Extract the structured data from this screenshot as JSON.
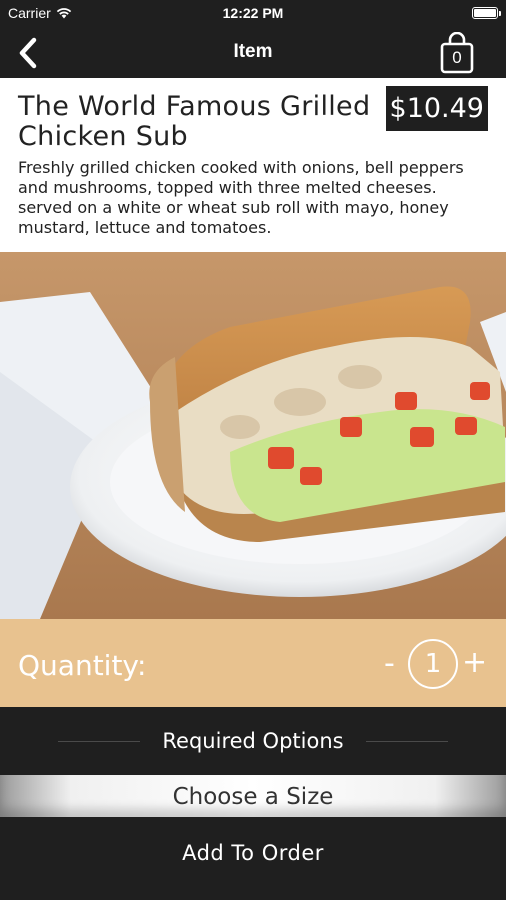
{
  "status_bar": {
    "carrier": "Carrier",
    "time": "12:22 PM",
    "battery_level": 1.0
  },
  "nav": {
    "title": "Item",
    "back_icon": "chevron-left-icon",
    "cart_icon": "shopping-bag-icon",
    "cart_count": "0"
  },
  "item": {
    "name": "The World Famous Grilled Chicken Sub",
    "price": "$10.49",
    "description": "Freshly grilled chicken cooked with onions, bell peppers and mushrooms, topped with three melted cheeses. served on a white or wheat sub roll with mayo, honey mustard, lettuce and tomatoes."
  },
  "quantity": {
    "label": "Quantity:",
    "minus": "-",
    "value": "1",
    "plus": "+"
  },
  "options": {
    "required_label": "Required Options",
    "size_label": "Choose a Size"
  },
  "actions": {
    "add_label": "Add To Order"
  },
  "colors": {
    "bar_dark": "#1f1f1f",
    "quantity_bg": "#e8c28f"
  }
}
